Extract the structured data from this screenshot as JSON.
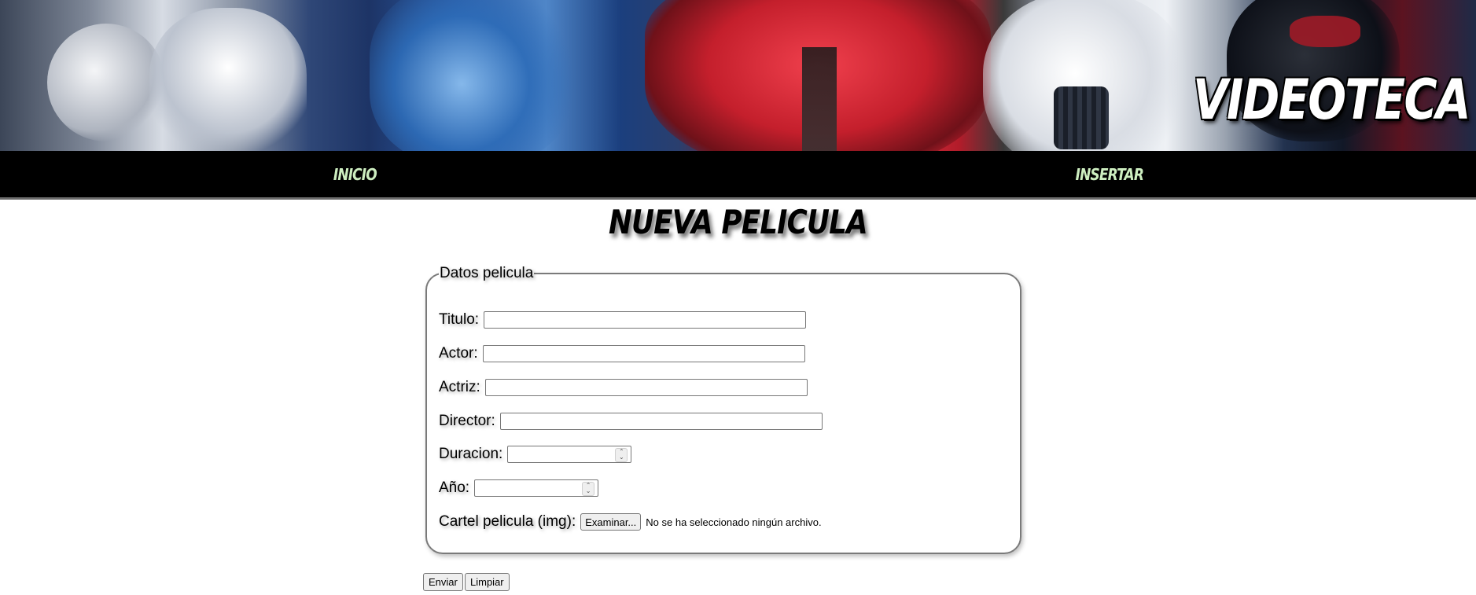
{
  "site": {
    "title": "VIDEOTECA"
  },
  "nav": {
    "items": [
      {
        "label": "INICIO"
      },
      {
        "label": "INSERTAR"
      }
    ]
  },
  "page": {
    "heading": "NUEVA PELICULA"
  },
  "form": {
    "legend": "Datos pelicula",
    "fields": {
      "titulo": {
        "label": "Titulo:",
        "value": ""
      },
      "actor": {
        "label": "Actor:",
        "value": ""
      },
      "actriz": {
        "label": "Actriz:",
        "value": ""
      },
      "director": {
        "label": "Director:",
        "value": ""
      },
      "duracion": {
        "label": "Duracion:",
        "value": ""
      },
      "anio": {
        "label": "Año:",
        "value": ""
      },
      "cartel": {
        "label": "Cartel pelicula (img):",
        "button_label": "Examinar...",
        "status": "No se ha seleccionado ningún archivo."
      }
    },
    "actions": {
      "submit_label": "Enviar",
      "reset_label": "Limpiar"
    }
  },
  "colors": {
    "nav_background": "#000000",
    "nav_link": "#cdeec0",
    "nav_border": "#6b6b6b",
    "page_background": "#ffffff"
  },
  "icons": {
    "spinner": "spinner-arrows-icon"
  }
}
